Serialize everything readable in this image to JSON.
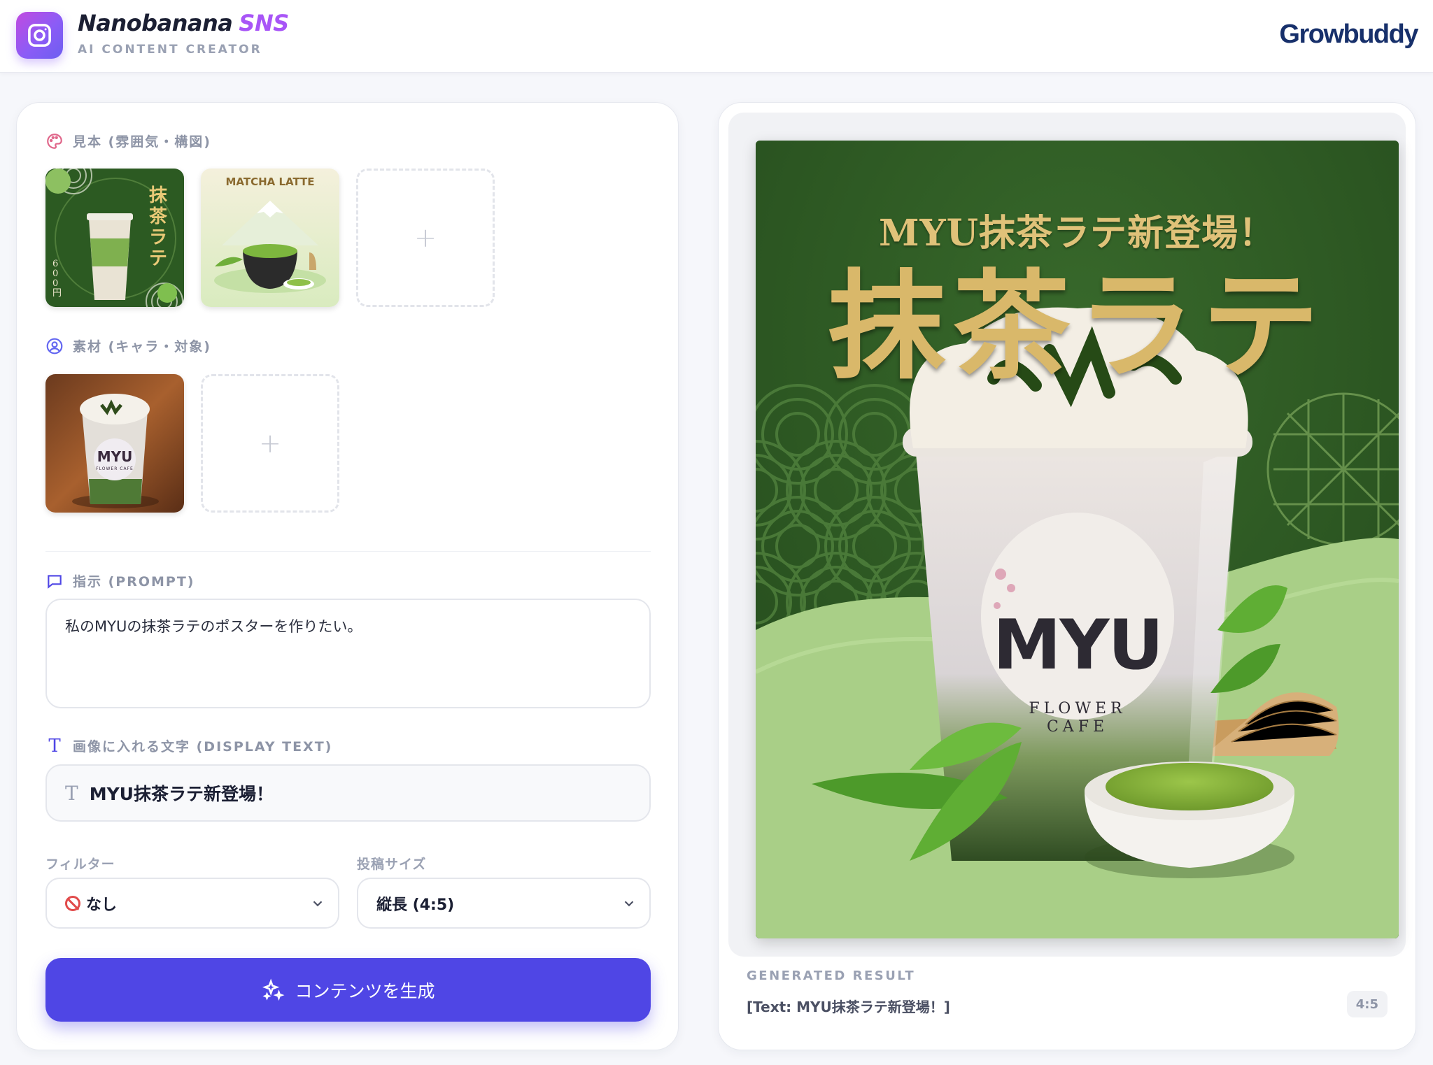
{
  "header": {
    "brand_name": "Nanobanana",
    "brand_suffix": "SNS",
    "brand_tagline": "AI CONTENT CREATOR",
    "partner_logo": "Growbuddy"
  },
  "references": {
    "label": "見本 (雰囲気・構図)",
    "icon": "palette-icon",
    "items": [
      {
        "name": "matcha-poster-thumbnail",
        "lines": [
          "抹茶",
          "ラテ"
        ],
        "price": "600円"
      },
      {
        "name": "matcha-latte-thumbnail",
        "title": "MATCHA LATTE"
      }
    ],
    "add_label": "+"
  },
  "materials": {
    "label": "素材 (キャラ・対象)",
    "icon": "user-circle-icon",
    "items": [
      {
        "name": "myu-cup-photo",
        "brand": "MYU",
        "sub": "FLOWER CAFE"
      }
    ],
    "add_label": "+"
  },
  "prompt": {
    "label": "指示 (PROMPT)",
    "icon": "message-square-icon",
    "value": "私のMYUの抹茶ラテのポスターを作りたい。"
  },
  "display_text": {
    "label": "画像に入れる文字 (DISPLAY TEXT)",
    "icon": "type-icon",
    "value": "MYU抹茶ラテ新登場！"
  },
  "filter": {
    "label": "フィルター",
    "selected": "なし"
  },
  "post_size": {
    "label": "投稿サイズ",
    "selected": "縦長 (4:5)"
  },
  "generate_button": {
    "label": "コンテンツを生成",
    "icon": "sparkles-icon"
  },
  "result": {
    "poster_subtitle": "MYU抹茶ラテ新登場！",
    "poster_title": "抹茶ラテ",
    "cup_brand": "MYU",
    "cup_sub_line1": "FLOWER",
    "cup_sub_line2": "CAFE",
    "label": "GENERATED RESULT",
    "text": "[Text: MYU抹茶ラテ新登場！]",
    "ratio": "4:5"
  },
  "colors": {
    "primary": "#4f46e5",
    "brand_accent": "#a855f7",
    "poster_dark_green": "#2f5a24",
    "poster_light_green": "#a9cf87",
    "poster_gold": "#d9b86a"
  }
}
